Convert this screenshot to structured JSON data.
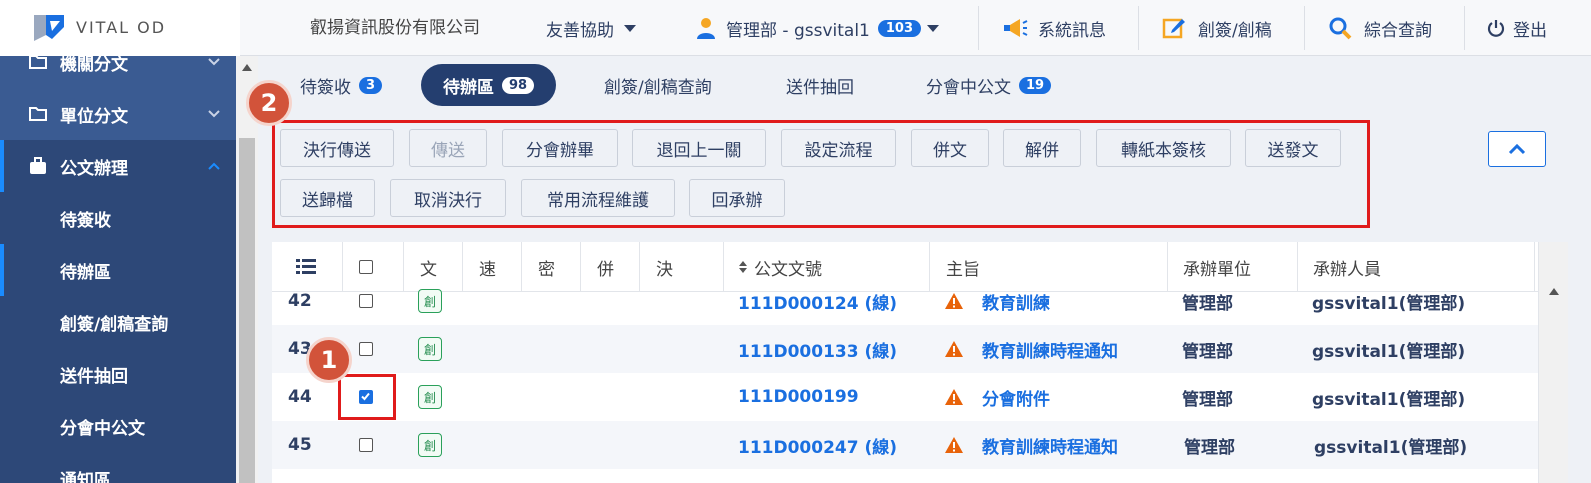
{
  "header": {
    "logo_text": "VITAL OD",
    "company": "叡揚資訊股份有限公司",
    "accessibility": "友善協助",
    "user": "管理部 - gssvital1",
    "user_badge": "103",
    "messages": "系統訊息",
    "create": "創簽/創稿",
    "search": "綜合查詢",
    "logout": "登出"
  },
  "sidebar": {
    "items": [
      {
        "label": "機關分文"
      },
      {
        "label": "單位分文"
      },
      {
        "label": "公文辦理"
      }
    ],
    "subitems": [
      {
        "label": "待簽收"
      },
      {
        "label": "待辦區"
      },
      {
        "label": "創簽/創稿查詢"
      },
      {
        "label": "送件抽回"
      },
      {
        "label": "分會中公文"
      },
      {
        "label": "通知區"
      }
    ]
  },
  "tabs": [
    {
      "label": "待簽收",
      "count": "3"
    },
    {
      "label": "待辦區",
      "count": "98"
    },
    {
      "label": "創簽/創稿查詢",
      "count": ""
    },
    {
      "label": "送件抽回",
      "count": ""
    },
    {
      "label": "分會中公文",
      "count": "19"
    }
  ],
  "annotations": [
    "1",
    "2"
  ],
  "toolbar": {
    "row1": [
      "決行傳送",
      "傳送",
      "分會辦畢",
      "退回上一關",
      "設定流程",
      "併文",
      "解併",
      "轉紙本簽核",
      "送發文"
    ],
    "row2": [
      "送歸檔",
      "取消決行",
      "常用流程維護",
      "回承辦"
    ]
  },
  "table": {
    "headers": {
      "wen": "文",
      "su": "速",
      "mi": "密",
      "bing": "併",
      "jue": "決",
      "doc_no": "公文文號",
      "subject": "主旨",
      "unit": "承辦單位",
      "person": "承辦人員"
    },
    "rows": [
      {
        "num": "42",
        "tag": "創",
        "doc_no": "111D000124 (線)",
        "subject": "教育訓練",
        "unit": "管理部",
        "person": "gssvital1(管理部)",
        "checked": false
      },
      {
        "num": "43",
        "tag": "創",
        "doc_no": "111D000133 (線)",
        "subject": "教育訓練時程通知",
        "unit": "管理部",
        "person": "gssvital1(管理部)",
        "checked": false
      },
      {
        "num": "44",
        "tag": "創",
        "doc_no": "111D000199",
        "subject": "分會附件",
        "unit": "管理部",
        "person": "gssvital1(管理部)",
        "checked": true
      },
      {
        "num": "45",
        "tag": "創",
        "doc_no": "111D000247 (線)",
        "subject": "教育訓練時程通知",
        "unit": "管理部",
        "person": "gssvital1(管理部)",
        "checked": false
      }
    ]
  },
  "colors": {
    "sidebar": "#2d4878",
    "accent": "#1a6fe0",
    "annotation": "#d2533a",
    "highlight": "#e01b1b"
  }
}
